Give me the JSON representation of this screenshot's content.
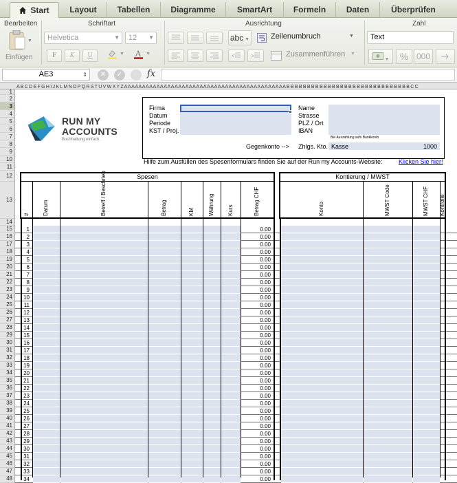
{
  "ribbon": {
    "tabs": [
      {
        "label": "Start",
        "active": true
      },
      {
        "label": "Layout",
        "active": false
      },
      {
        "label": "Tabellen",
        "active": false
      },
      {
        "label": "Diagramme",
        "active": false
      },
      {
        "label": "SmartArt",
        "active": false
      },
      {
        "label": "Formeln",
        "active": false
      },
      {
        "label": "Daten",
        "active": false
      },
      {
        "label": "Überprüfen",
        "active": false
      }
    ],
    "groups": {
      "bearbeiten": "Bearbeiten",
      "schriftart": "Schriftart",
      "ausrichtung": "Ausrichtung",
      "zahl": "Zahl"
    },
    "paste_label": "Einfügen",
    "font_name": "Helvetica",
    "font_size": "12",
    "bold": "F",
    "italic": "K",
    "underline": "U",
    "abc_label": "abc",
    "wrap_label": "Zeilenumbruch",
    "merge_label": "Zusammenführen",
    "number_format": "Text",
    "percent": "%",
    "thousands": "000"
  },
  "formula_bar": {
    "name_box": "AE3",
    "fx": "fx",
    "value": ""
  },
  "colors": {
    "input_fill": "#dde3ee",
    "selection": "#2f5fb8",
    "link": "#0000ee"
  },
  "sheet": {
    "column_letters": "A B C D E F G H I J K L M N O P Q R S T U V W X Y Z A A A A A A A A A A A A A A A A A A A A A A A A A A A A A A A A A A A A A A A A A A A A A B B B B B B B B B B B B B B B B B B B B B B B B B B B B B B C C",
    "logo_line1": "RUN MY",
    "logo_line2": "ACCOUNTS",
    "logo_tagline": "Buchhaltung einfach.",
    "labels_left": [
      "Firma",
      "Datum",
      "Periode",
      "KST / Proj."
    ],
    "labels_right": [
      "Name",
      "Strasse",
      "PLZ / Ort",
      "IBAN"
    ],
    "bank_note": "Bei Auszahlung aufs Bankkonto",
    "gegenkonto": "Gegenkonto -->",
    "zahlgs_kto": "Zhlgs. Kto.",
    "kasse": "Kasse",
    "kasse_nr": "1000",
    "help_text": "Hilfe zum Ausfüllen des Spesenformulars finden Sie auf der Run my Accounts-Website:",
    "help_link": "Klicken Sie hier!",
    "spesen_title": "Spesen",
    "kontierung_title": "Kontierung / MWST",
    "spesen_cols": [
      "#",
      "Datum",
      "Betreff / Beschrieb",
      "Betrag",
      "KM",
      "Währung",
      "Kurs",
      "Betrag CHF"
    ],
    "kontierung_cols": [
      "Konto",
      "MWST Code",
      "MWST CHF",
      "Kontrolle"
    ],
    "row_numbers": [
      "1",
      "2",
      "3",
      "4",
      "5",
      "6",
      "7",
      "8",
      "9",
      "10",
      "11",
      "12",
      "13",
      "14",
      "15",
      "16",
      "17",
      "18",
      "19",
      "20",
      "21",
      "22",
      "23",
      "24",
      "25",
      "26",
      "27",
      "28",
      "29",
      "30",
      "31",
      "32",
      "33",
      "34"
    ],
    "row_value": "0.00",
    "excel_rows_top": [
      "1",
      "2",
      "3",
      "4",
      "5",
      "6",
      "7",
      "8",
      "9",
      "10",
      "11",
      "12",
      "13",
      "14"
    ],
    "excel_rows_data": [
      "15",
      "16",
      "17",
      "18",
      "19",
      "20",
      "21",
      "22",
      "23",
      "24",
      "25",
      "26",
      "27",
      "28",
      "29",
      "30",
      "31",
      "32",
      "33",
      "34",
      "35",
      "36",
      "37",
      "38",
      "39",
      "40",
      "41",
      "42",
      "43",
      "44",
      "45",
      "46",
      "47",
      "48"
    ]
  }
}
